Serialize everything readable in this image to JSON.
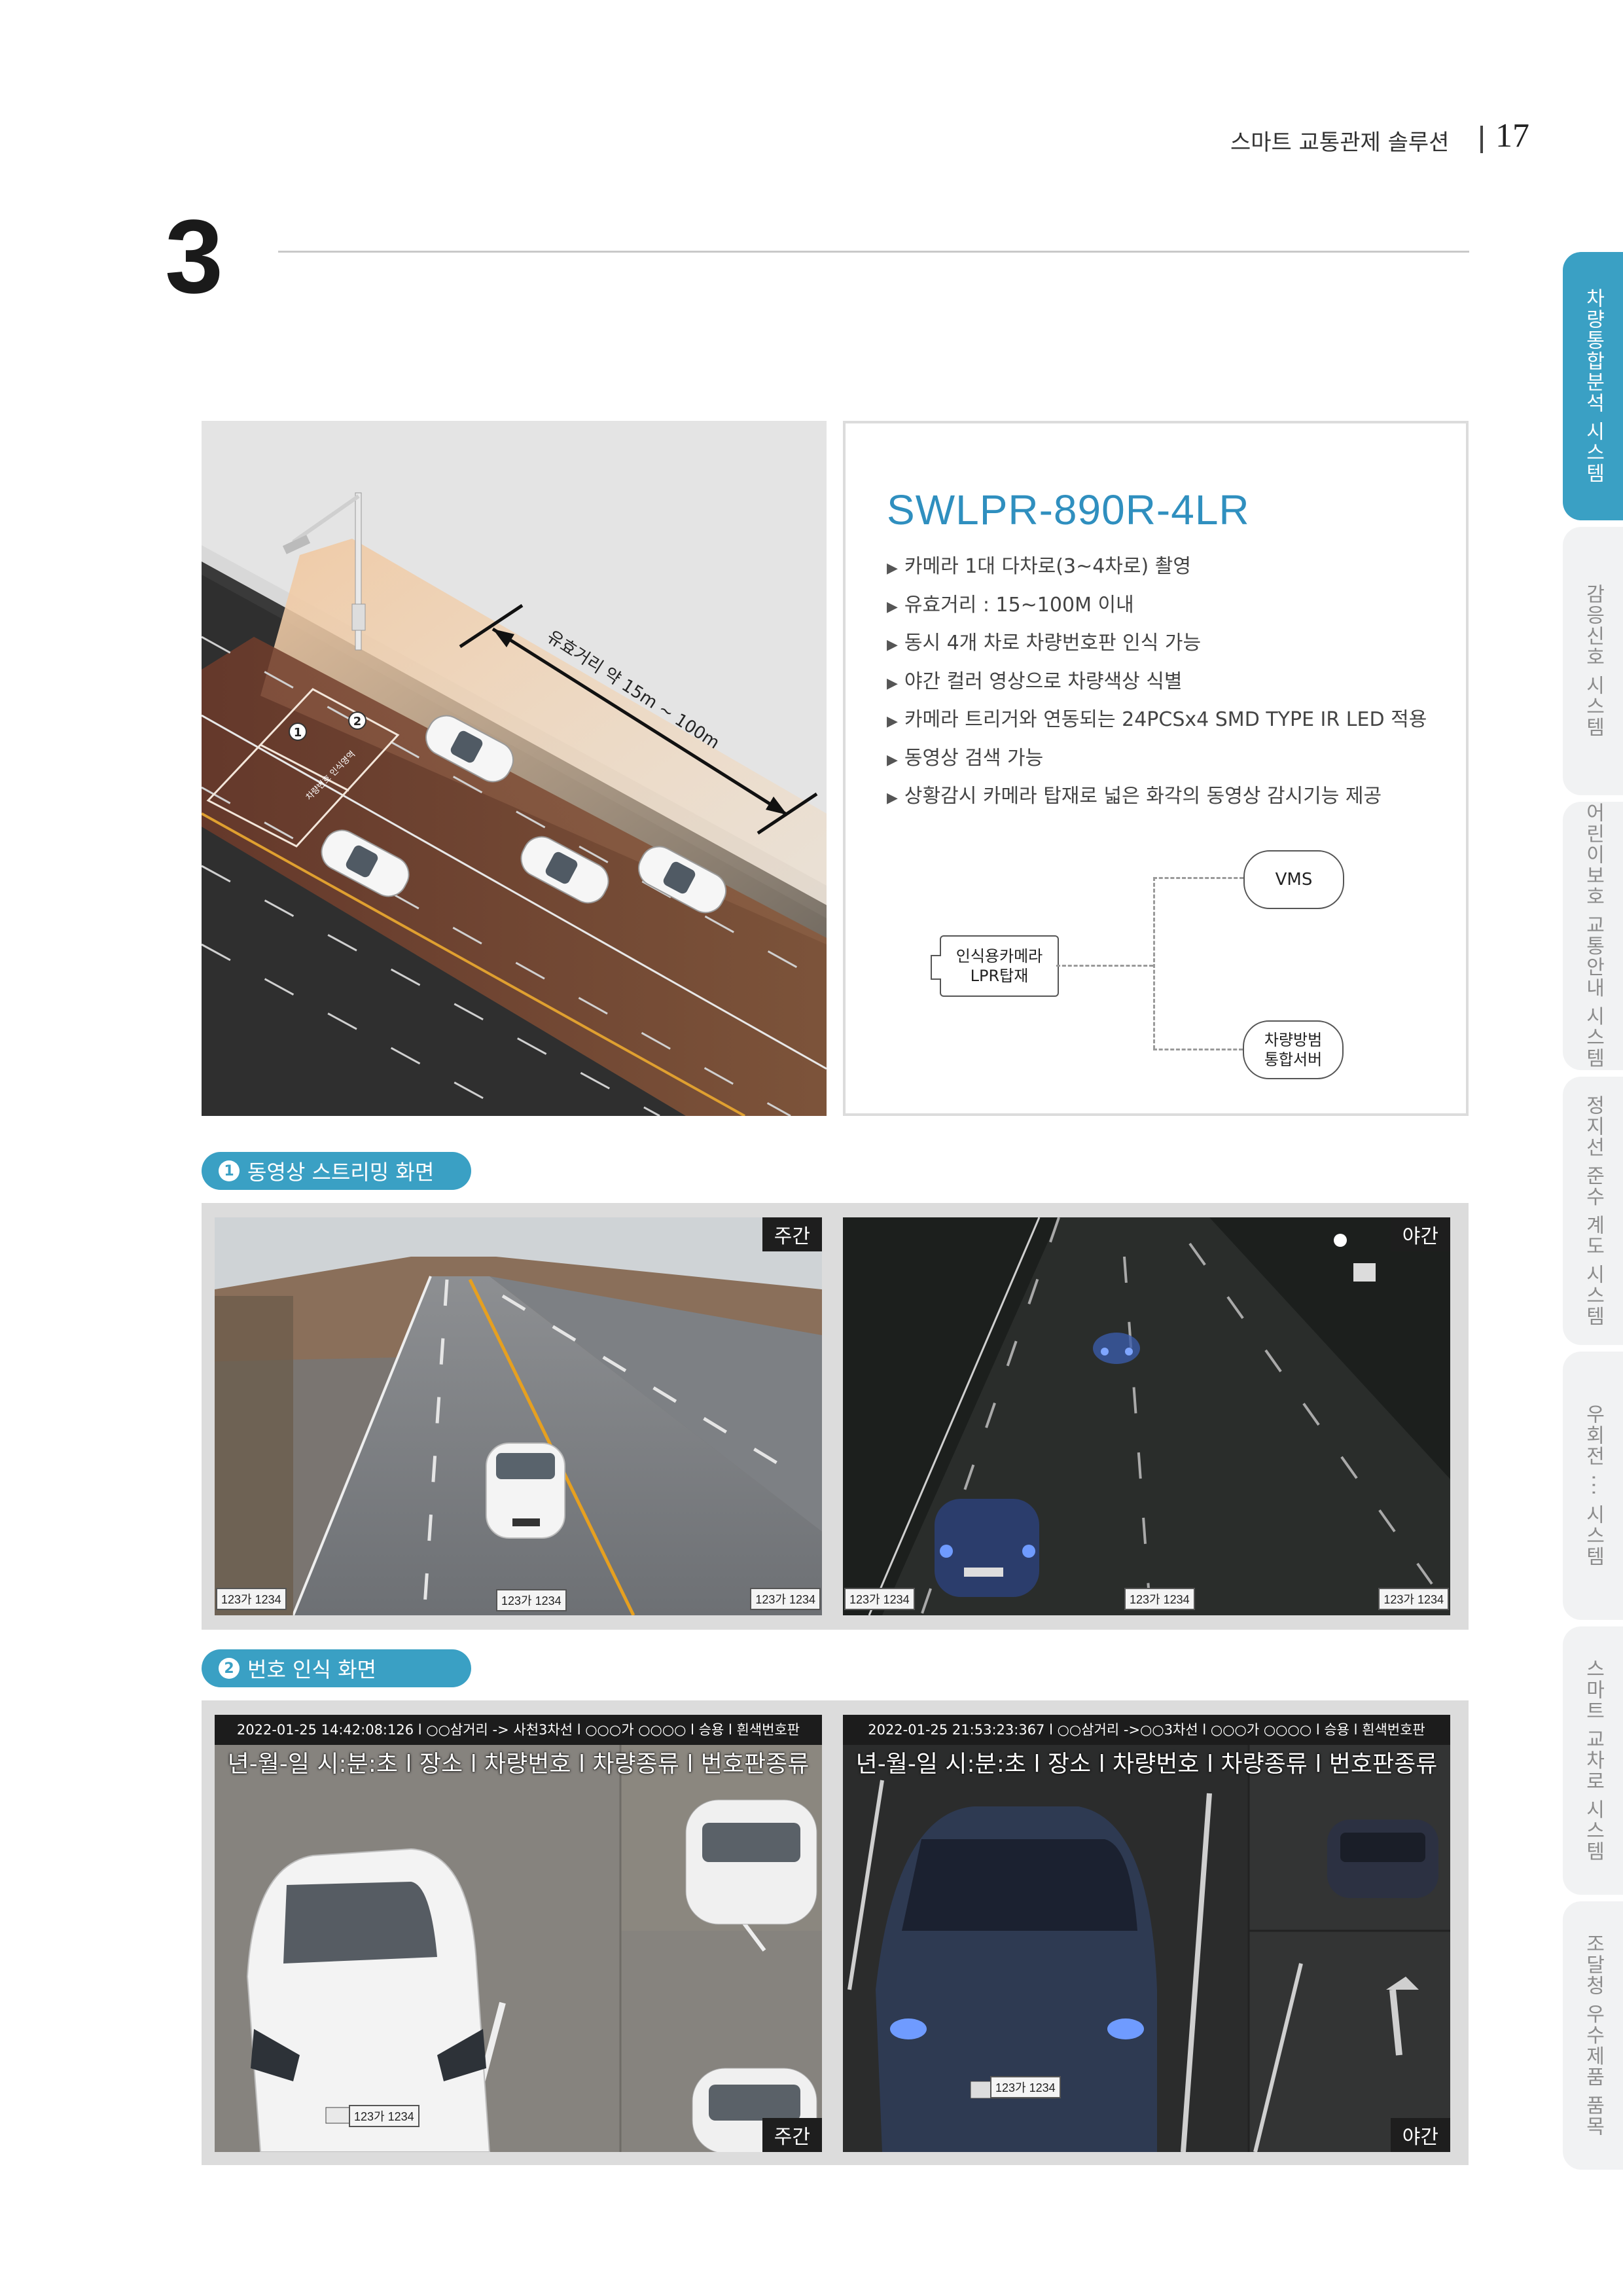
{
  "header": {
    "title": "스마트 교통관제 솔루션",
    "page_number": "17"
  },
  "section": {
    "number": "3"
  },
  "side_tabs": [
    "차량통합분석 시스템",
    "감응신호 시스템",
    "어린이보호 교통안내 시스템",
    "정지선 준수 계도 시스템",
    "우회전 ··· 시스템",
    "스마트 교차로 시스템",
    "조달청 우수제품 품목"
  ],
  "illustration": {
    "distance_label": "유효거리 약 15m ~ 100m",
    "zone_label": "차량번호 인식영역",
    "markers": [
      "1",
      "2"
    ]
  },
  "spec": {
    "product_name": "SWLPR-890R-4LR",
    "features": [
      "카메라 1대 다차로(3~4차로) 촬영",
      "유효거리 : 15~100M 이내",
      "동시 4개 차로 차량번호판 인식 가능",
      "야간 컬러 영상으로 차량색상 식별",
      "카메라 트리거와 연동되는 24PCSx4 SMD TYPE IR LED 적용",
      "동영상 검색 가능",
      "상황감시 카메라 탑재로 넓은 화각의 동영상 감시기능 제공"
    ],
    "bullet": "▶",
    "diagram": {
      "camera": "인식용카메라\nLPR탑재",
      "vms": "VMS",
      "server": "차량방범\n통합서버"
    }
  },
  "streaming": {
    "number": "1",
    "title": "동영상 스트리밍 화면",
    "day_label": "주간",
    "night_label": "야간",
    "plate_text": "123가 1234"
  },
  "recognition": {
    "number": "2",
    "title": "번호 인식 화면",
    "day_info": "2022-01-25 14:42:08:126 l ○○삼거리 -> 사천3차선  l  ○○○가 ○○○○  l  승용  l  흰색번호판",
    "night_info": "2022-01-25 21:53:23:367 l ○○삼거리 ->○○3차선  l  ○○○가 ○○○○  l  승용  l  흰색번호판",
    "field_line": "년-월-일  시:분:초  l 장소 l 차량번호 l 차량종류 l 번호판종류",
    "day_label": "주간",
    "night_label": "야간",
    "plate_text": "123가 1234"
  },
  "colors": {
    "accent": "#3aa0c4",
    "product": "#2f8fbf",
    "road": "#2e2e2e",
    "glow": "#c98a5a"
  }
}
